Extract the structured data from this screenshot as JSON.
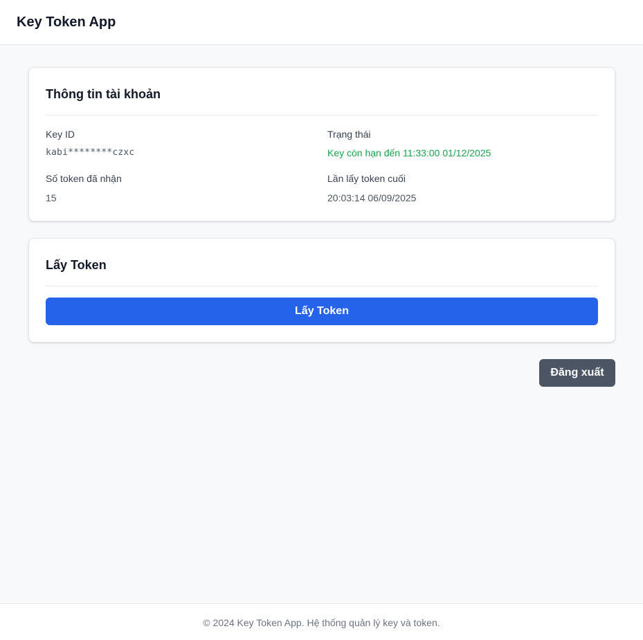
{
  "header": {
    "app_title": "Key Token App"
  },
  "account_info": {
    "title": "Thông tin tài khoản",
    "key_id_label": "Key ID",
    "key_id_value": "kabi********czxc",
    "status_label": "Trạng thái",
    "status_value": "Key còn hạn đến 11:33:00 01/12/2025",
    "tokens_received_label": "Số token đã nhận",
    "tokens_received_value": "15",
    "last_token_label": "Lần lấy token cuối",
    "last_token_value": "20:03:14 06/09/2025"
  },
  "get_token": {
    "title": "Lấy Token",
    "button_label": "Lấy Token"
  },
  "actions": {
    "logout_label": "Đăng xuất"
  },
  "footer": {
    "text": "© 2024 Key Token App. Hệ thống quản lý key và token."
  },
  "colors": {
    "primary": "#2563eb",
    "logout": "#4b5563",
    "status_ok": "#16a34a",
    "page_background": "#f8f9fb"
  }
}
